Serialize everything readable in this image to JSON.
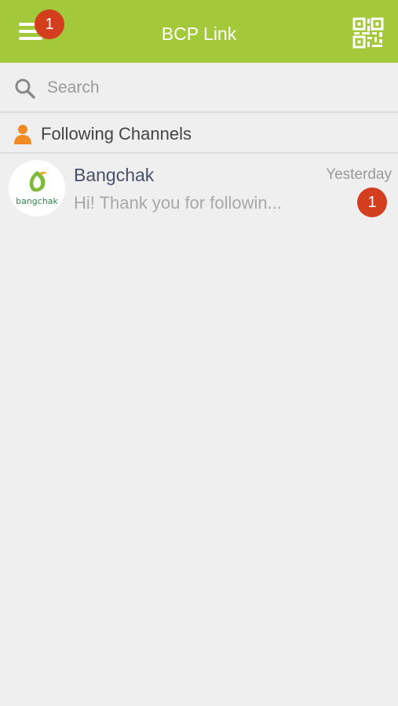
{
  "header": {
    "title": "BCP Link",
    "menu_icon": "hamburger-menu-icon",
    "menu_badge": "1",
    "qr_icon": "qr-code-icon",
    "accent_color": "#a3c93b"
  },
  "search": {
    "placeholder": "Search",
    "value": "",
    "icon": "search-icon"
  },
  "section": {
    "title": "Following Channels",
    "icon": "person-icon",
    "icon_color": "#f08a24"
  },
  "channels": [
    {
      "name": "Bangchak",
      "logo_text": "bangchak",
      "time": "Yesterday",
      "preview": "Hi! Thank you for followin...",
      "unread": "1"
    }
  ],
  "badge_color": "#d33e1e"
}
